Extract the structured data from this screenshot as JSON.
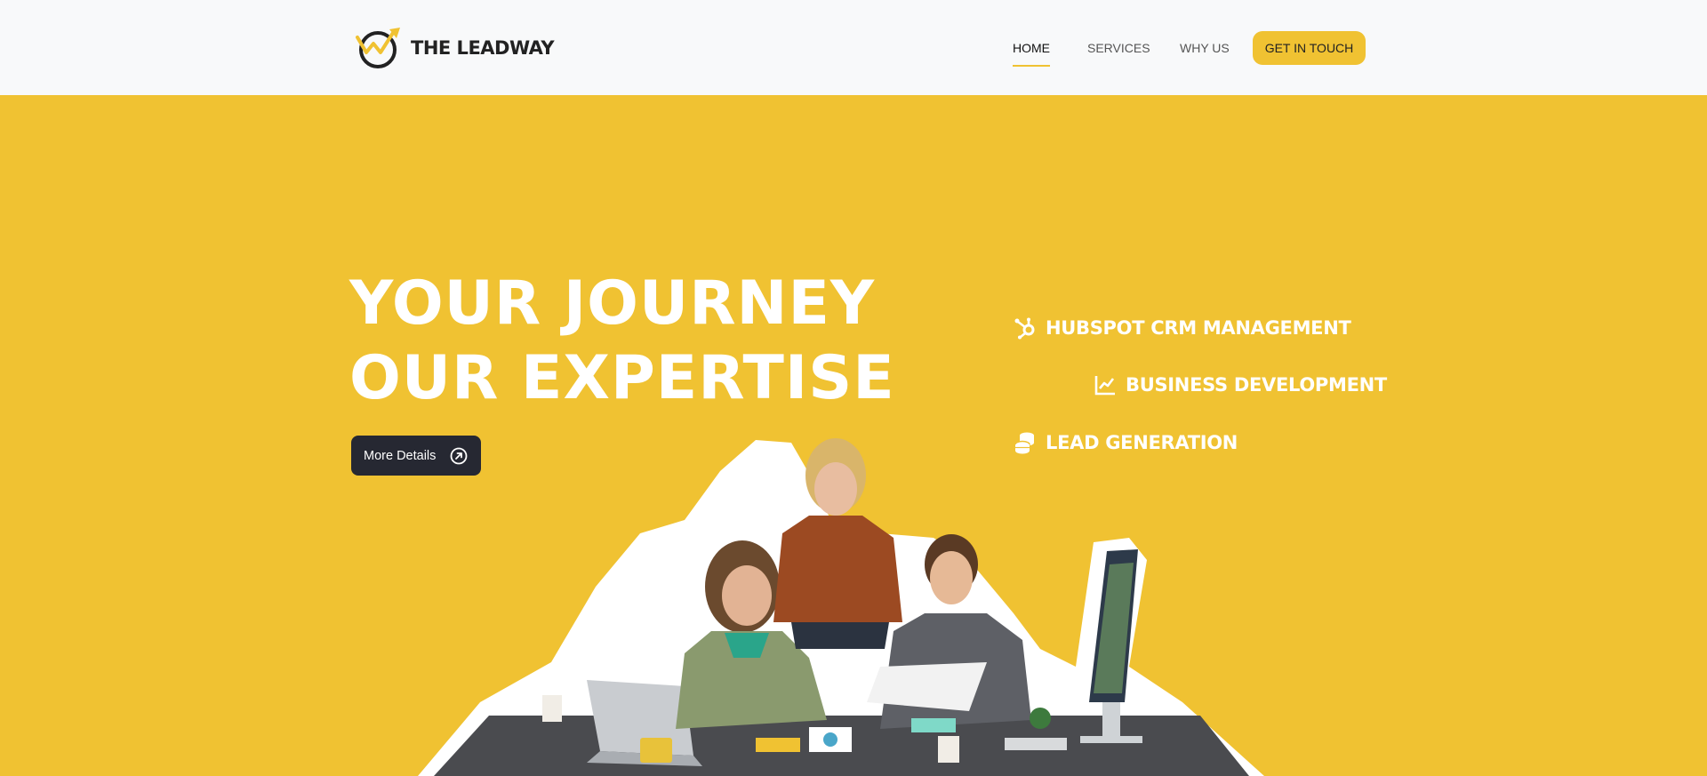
{
  "brand": {
    "name": "THE LEADWAY",
    "accent": "#f0c232",
    "dark": "#262832"
  },
  "nav": {
    "items": [
      {
        "label": "HOME",
        "active": true
      },
      {
        "label": "SERVICES",
        "active": false
      },
      {
        "label": "WHY US",
        "active": false
      }
    ],
    "cta_label": "GET IN TOUCH"
  },
  "hero": {
    "headline_line1": "YOUR JOURNEY",
    "headline_line2": "OUR EXPERTISE",
    "button_label": "More Details",
    "button_icon": "arrow-up-right-circle-icon"
  },
  "services": [
    {
      "label": "HUBSPOT CRM MANAGEMENT",
      "icon": "hubspot-icon"
    },
    {
      "label": "BUSINESS DEVELOPMENT",
      "icon": "line-chart-icon"
    },
    {
      "label": "LEAD GENERATION",
      "icon": "coins-icon"
    }
  ]
}
